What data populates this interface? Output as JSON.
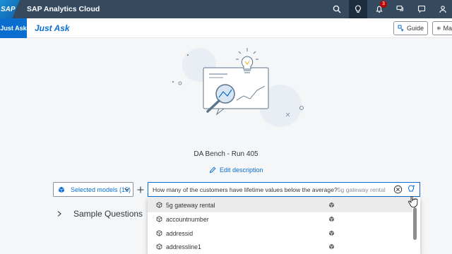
{
  "shell": {
    "logo_text": "SAP",
    "app_title": "SAP Analytics Cloud",
    "notifications_count": "3",
    "icons": [
      "search-icon",
      "lightbulb-icon",
      "bell-icon",
      "discussion-icon",
      "feedback-icon",
      "user-icon"
    ]
  },
  "subheader": {
    "nav_label": "Just Ask",
    "page_title": "Just Ask",
    "guide_label": "Guide",
    "manage_label": "Ma"
  },
  "story": {
    "title": "DA Bench - Run 405",
    "edit_label": "Edit description"
  },
  "query": {
    "models_label": "Selected models (15)",
    "text": "How many of the customers have lifetime values below the average?",
    "hint": "5g gateway rental"
  },
  "sample_questions_label": "Sample Questions",
  "suggestions": [
    {
      "label": "5g gateway rental",
      "selected": true
    },
    {
      "label": "accountnumber",
      "selected": false
    },
    {
      "label": "addressid",
      "selected": false
    },
    {
      "label": "addressline1",
      "selected": false
    }
  ],
  "colors": {
    "shell": "#354a5f",
    "accent": "#0a6ed1",
    "badge": "#bb0000"
  }
}
